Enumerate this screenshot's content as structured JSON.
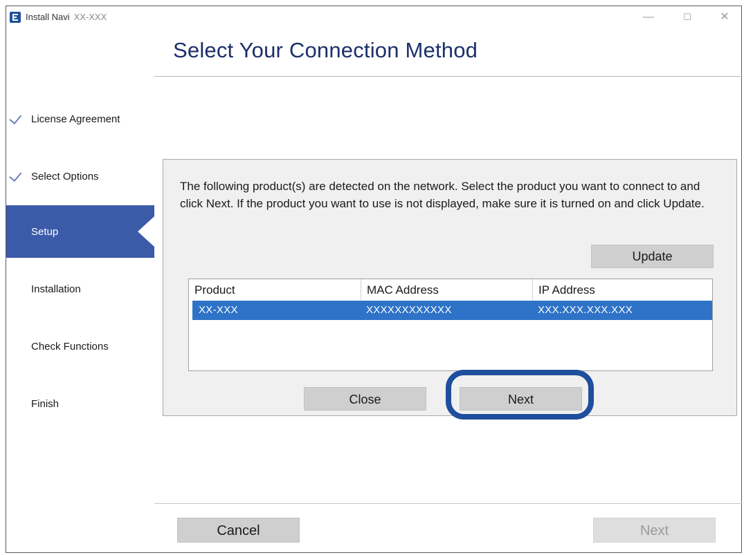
{
  "window": {
    "app_name": "Install Navi",
    "model": "XX-XXX",
    "controls": {
      "minimize": "—",
      "maximize": "☐",
      "close": "✕"
    }
  },
  "sidebar": {
    "items": [
      {
        "label": "License Agreement",
        "state": "done"
      },
      {
        "label": "Select Options",
        "state": "done"
      },
      {
        "label": "Setup",
        "state": "active"
      },
      {
        "label": "Installation",
        "state": "pending"
      },
      {
        "label": "Check Functions",
        "state": "pending"
      },
      {
        "label": "Finish",
        "state": "pending"
      }
    ]
  },
  "main": {
    "title": "Select Your Connection Method",
    "message": "The following product(s) are detected on the network. Select the product you want to connect to and click Next. If the product you want to use is not displayed, make sure it is turned on and click Update.",
    "update_label": "Update",
    "table": {
      "columns": [
        "Product",
        "MAC Address",
        "IP Address"
      ],
      "rows": [
        {
          "product": "XX-XXX",
          "mac": "XXXXXXXXXXXX",
          "ip": "XXX.XXX.XXX.XXX",
          "selected": true
        }
      ]
    },
    "close_label": "Close",
    "next_label": "Next"
  },
  "footer": {
    "cancel_label": "Cancel",
    "next_label": "Next"
  },
  "colors": {
    "accent": "#3b5aa8",
    "title": "#1c2f6a",
    "selection": "#2e73c7",
    "highlight_ring": "#1e4f9c"
  }
}
